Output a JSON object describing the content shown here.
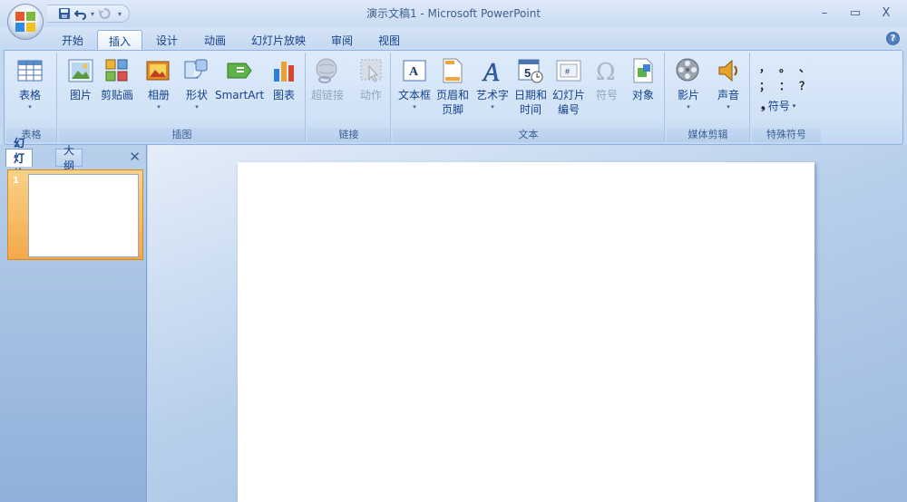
{
  "window": {
    "title": "演示文稿1 - Microsoft PowerPoint",
    "minimize_symbol": "–",
    "maximize_symbol": "▭",
    "close_symbol": "X"
  },
  "qat": {
    "save_icon": "save-icon",
    "undo_icon": "undo-icon",
    "redo_icon": "redo-icon",
    "customize_icon": "customize-qat-icon"
  },
  "tabs": [
    {
      "label": "开始"
    },
    {
      "label": "插入",
      "active": true
    },
    {
      "label": "设计"
    },
    {
      "label": "动画"
    },
    {
      "label": "幻灯片放映"
    },
    {
      "label": "审阅"
    },
    {
      "label": "视图"
    }
  ],
  "help_symbol": "?",
  "ribbon": {
    "groups": {
      "table": {
        "label": "表格",
        "buttons": [
          {
            "label": "表格",
            "dropdown": "▾"
          }
        ]
      },
      "illustrations": {
        "label": "插图",
        "buttons": [
          {
            "label": "图片"
          },
          {
            "label": "剪贴画"
          },
          {
            "label": "相册",
            "dropdown": "▾"
          },
          {
            "label": "形状",
            "dropdown": "▾"
          },
          {
            "label": "SmartArt"
          },
          {
            "label": "图表"
          }
        ]
      },
      "links": {
        "label": "链接",
        "buttons": [
          {
            "label": "超链接",
            "disabled": true
          },
          {
            "label": "动作",
            "disabled": true
          }
        ]
      },
      "text": {
        "label": "文本",
        "buttons": [
          {
            "label": "文本框",
            "dropdown": "▾"
          },
          {
            "label": "页眉和",
            "label2": "页脚"
          },
          {
            "label": "艺术字",
            "dropdown": "▾"
          },
          {
            "label": "日期和",
            "label2": "时间"
          },
          {
            "label": "幻灯片",
            "label2": "编号"
          },
          {
            "label": "符号",
            "disabled": true
          },
          {
            "label": "对象"
          }
        ]
      },
      "media": {
        "label": "媒体剪辑",
        "buttons": [
          {
            "label": "影片",
            "dropdown": "▾"
          },
          {
            "label": "声音",
            "dropdown": "▾"
          }
        ]
      },
      "special": {
        "label": "特殊符号",
        "symbols": [
          "，",
          "。",
          "、",
          "；",
          "：",
          "？"
        ],
        "button": {
          "label": "符号",
          "dropdown": "▾",
          "prefix": "❟"
        }
      }
    }
  },
  "left_pane": {
    "tabs": [
      {
        "label": "幻灯片",
        "active": true
      },
      {
        "label": "大纲"
      }
    ],
    "close_symbol": "✕",
    "thumbnails": [
      {
        "number": "1"
      }
    ]
  }
}
